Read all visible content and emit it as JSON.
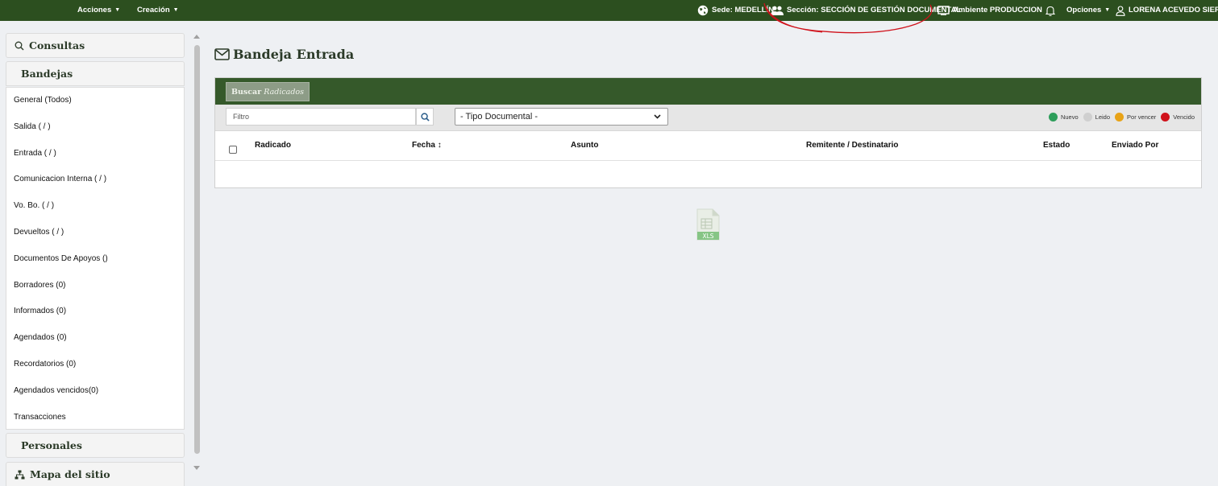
{
  "topbar": {
    "acciones": "Acciones",
    "creacion": "Creación",
    "sede": "Sede: MEDELLÍN",
    "seccion": "Sección: SECCIÓN DE GESTIÓN DOCUMENTAL",
    "ambiente": "Ambiente PRODUCCION",
    "opciones": "Opciones",
    "user": "LORENA ACEVEDO SIERRA"
  },
  "sidebar": {
    "consultas": "Consultas",
    "bandejas": "Bandejas",
    "items": [
      {
        "label": "General (Todos)"
      },
      {
        "label": "Salida ( / )"
      },
      {
        "label": "Entrada ( / )"
      },
      {
        "label": "Comunicacion Interna ( / )"
      },
      {
        "label": "Vo. Bo. ( / )"
      },
      {
        "label": "Devueltos ( / )"
      },
      {
        "label": "Documentos De Apoyos ()"
      },
      {
        "label": "Borradores (0)"
      },
      {
        "label": "Informados (0)"
      },
      {
        "label": "Agendados (0)"
      },
      {
        "label": "Recordatorios (0)"
      },
      {
        "label": "Agendados vencidos(0)"
      },
      {
        "label": "Transacciones"
      }
    ],
    "personales": "Personales",
    "mapa": "Mapa del sitio"
  },
  "main": {
    "title": "Bandeja Entrada",
    "search_button": {
      "prefix": "Buscar",
      "suffix": "Radicados"
    },
    "filter_placeholder": "Filtro",
    "tipo_documental": "- Tipo Documental -",
    "legend": [
      {
        "label": "Nuevo",
        "color": "#2e9e5b"
      },
      {
        "label": "Leido",
        "color": "#cfcfcf"
      },
      {
        "label": "Por vencer",
        "color": "#e8a317"
      },
      {
        "label": "Vencido",
        "color": "#d0121b"
      }
    ],
    "columns": {
      "radicado": "Radicado",
      "fecha": "Fecha",
      "asunto": "Asunto",
      "remitente": "Remitente / Destinatario",
      "estado": "Estado",
      "enviado": "Enviado Por"
    },
    "export_icon_label": "XLS"
  },
  "colors": {
    "topbar": "#2c4f1f",
    "panel_header": "#35592a",
    "annotation": "#d0121b"
  }
}
